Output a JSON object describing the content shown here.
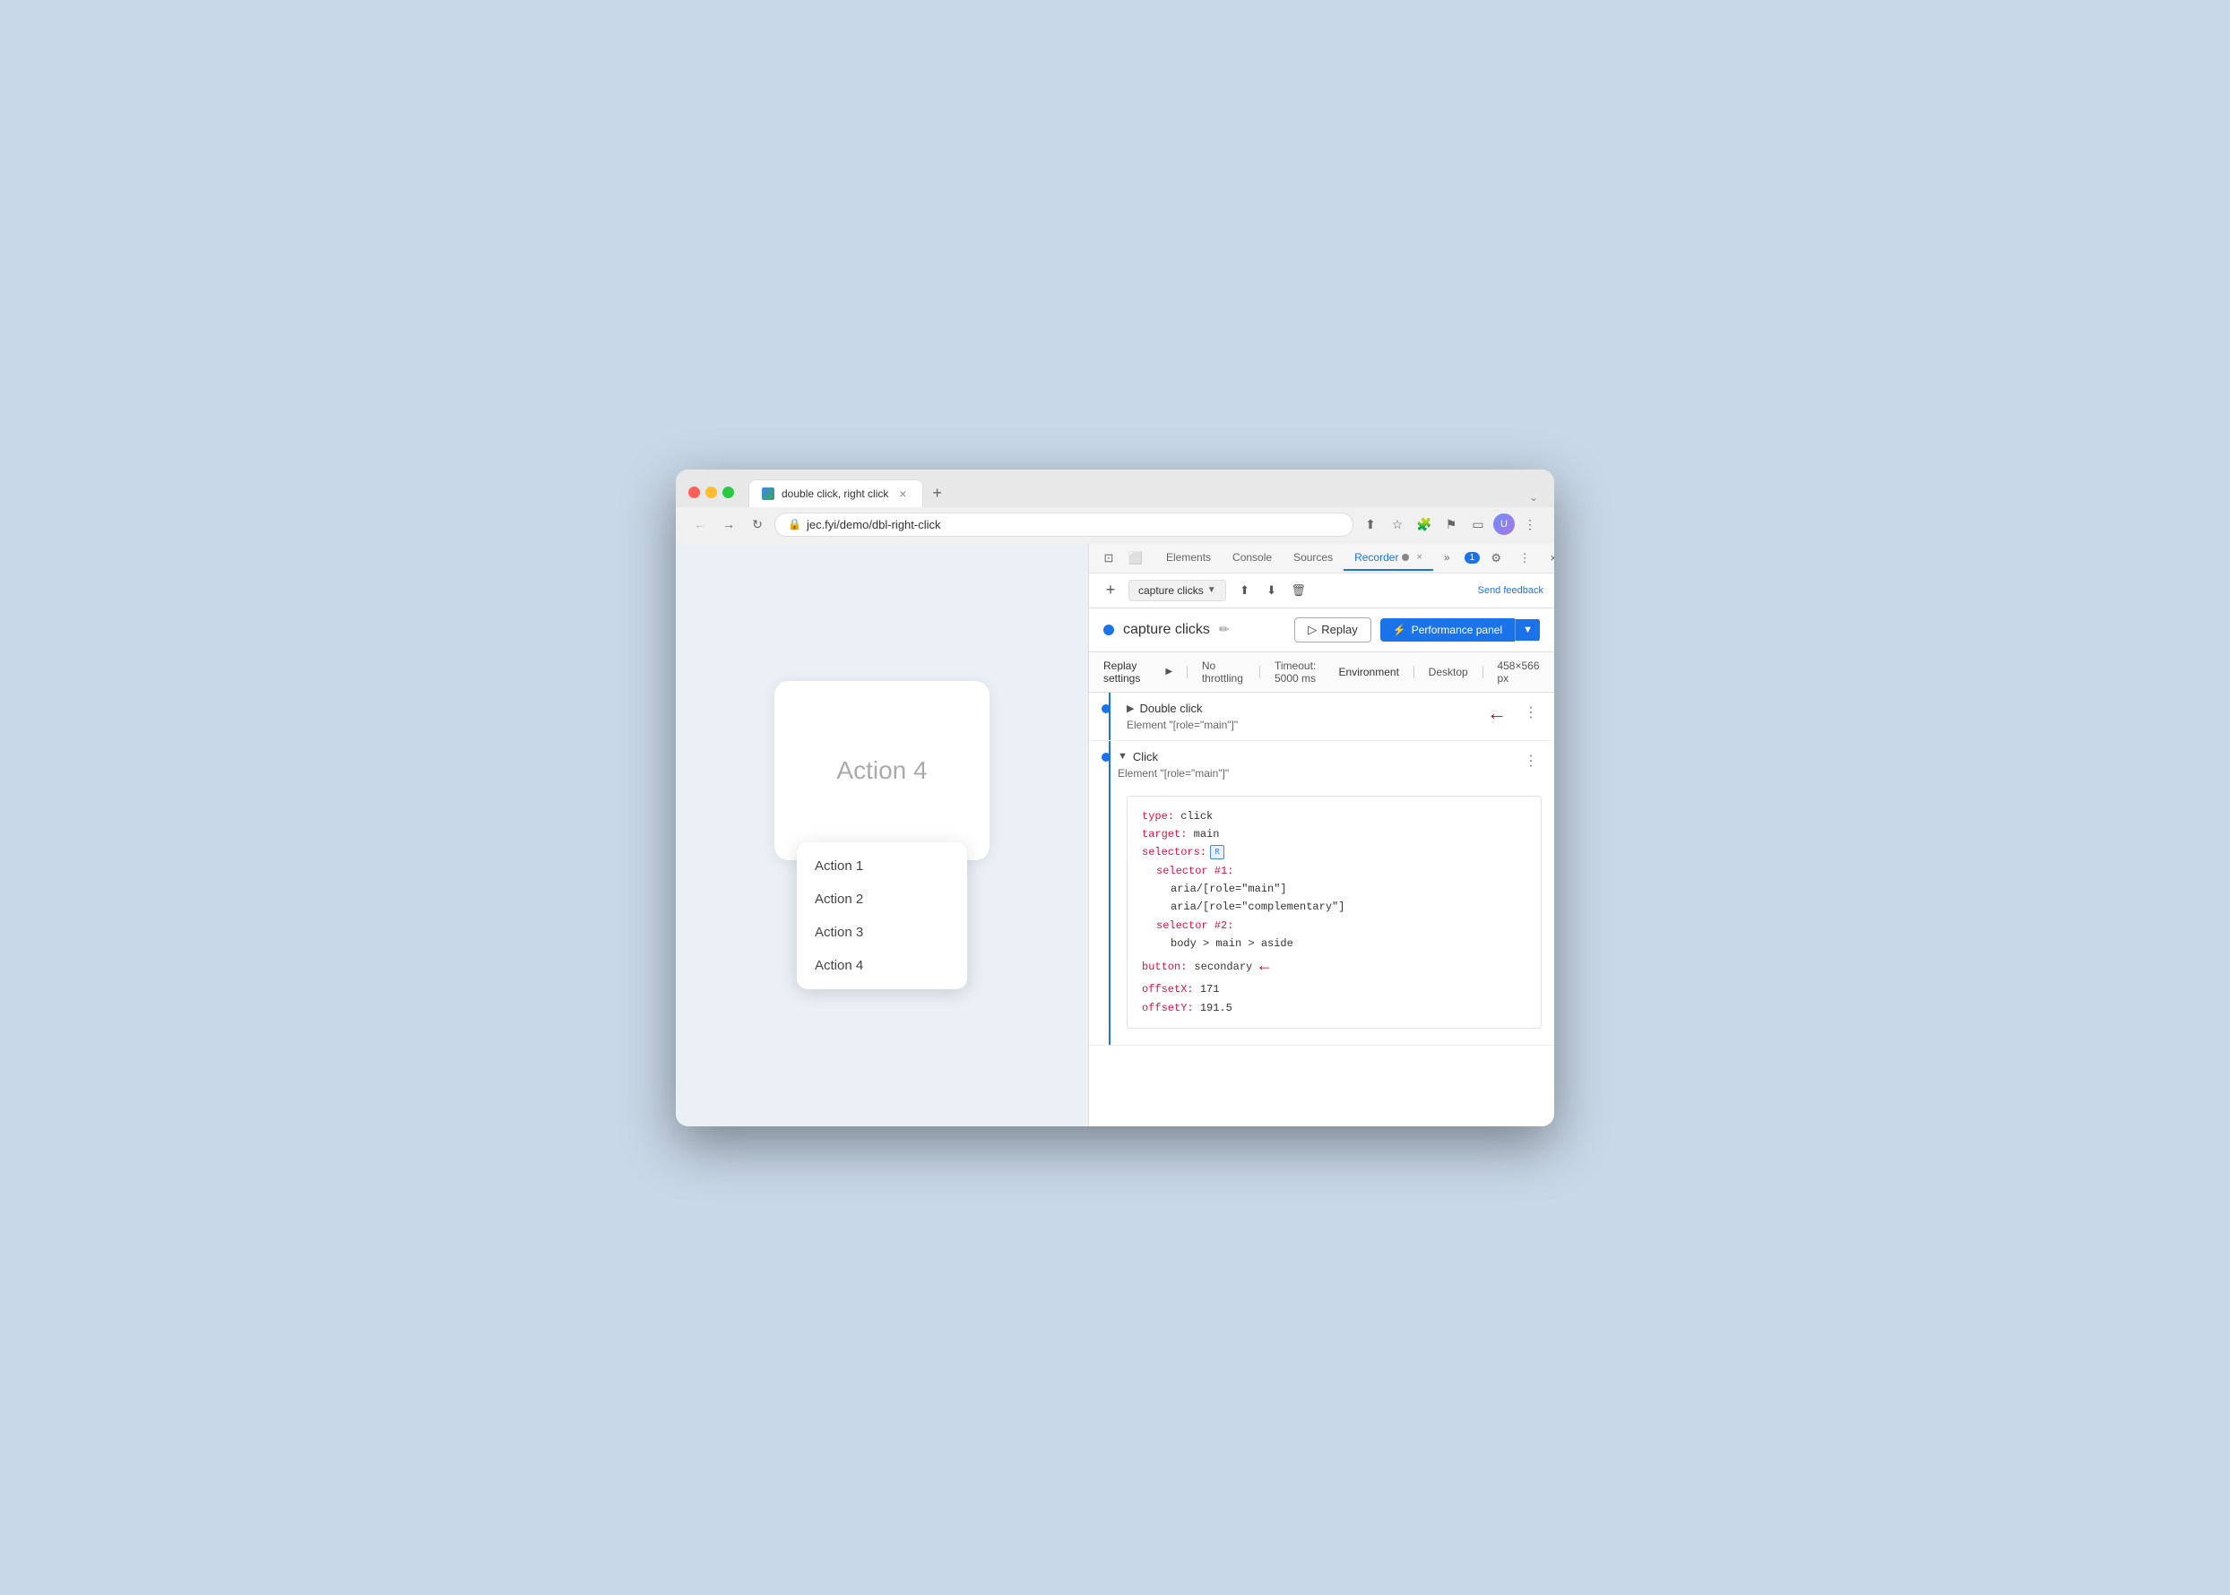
{
  "browser": {
    "tab_title": "double click, right click",
    "tab_new_label": "+",
    "tab_expand_label": "⌄",
    "url": "jec.fyi/demo/dbl-right-click",
    "nav": {
      "back": "←",
      "forward": "→",
      "refresh": "↻"
    }
  },
  "page": {
    "action4_label": "Action 4",
    "context_menu": {
      "items": [
        "Action 1",
        "Action 2",
        "Action 3",
        "Action 4"
      ]
    }
  },
  "devtools": {
    "tabs": [
      "Elements",
      "Console",
      "Sources",
      "Recorder",
      "»"
    ],
    "recorder_tab_label": "Recorder",
    "recorder_close": "×",
    "badge_count": "1",
    "toolbar": {
      "add_label": "+",
      "recording_name": "capture clicks",
      "export_label": "⬆",
      "import_label": "⬇",
      "delete_label": "🗑",
      "send_feedback": "Send feedback"
    },
    "header": {
      "recording_name": "capture clicks",
      "edit_icon": "✏",
      "replay_label": "Replay",
      "perf_panel_label": "Performance panel",
      "perf_arrow": "▼"
    },
    "settings": {
      "replay_settings": "Replay settings",
      "throttling": "No throttling",
      "timeout": "Timeout: 5000 ms",
      "environment_label": "Environment",
      "environment_val": "Desktop",
      "dimensions": "458×566 px"
    },
    "steps": [
      {
        "type": "Double click",
        "element": "Element \"[role=\"main\"]\"",
        "expanded": false,
        "has_arrow": true
      },
      {
        "type": "Click",
        "element": "Element \"[role=\"main\"]\"",
        "expanded": true,
        "has_arrow": false,
        "code": {
          "type_key": "type:",
          "type_val": "click",
          "target_key": "target:",
          "target_val": "main",
          "selectors_key": "selectors:",
          "selector1_key": "selector #1:",
          "aria1": "aria/[role=\"main\"]",
          "aria2": "aria/[role=\"complementary\"]",
          "selector2_key": "selector #2:",
          "body_path": "body > main > aside",
          "button_key": "button:",
          "button_val": "secondary",
          "offsetx_key": "offsetX:",
          "offsetx_val": "171",
          "offsety_key": "offsetY:",
          "offsety_val": "191.5"
        },
        "has_code_arrow": true
      }
    ]
  },
  "icons": {
    "shield": "🔒",
    "star": "☆",
    "puzzle": "🧩",
    "flag": "⚑",
    "sidebar": "▭",
    "more": "⋮",
    "share": "⬆",
    "play": "▷",
    "perf": "⚡"
  }
}
